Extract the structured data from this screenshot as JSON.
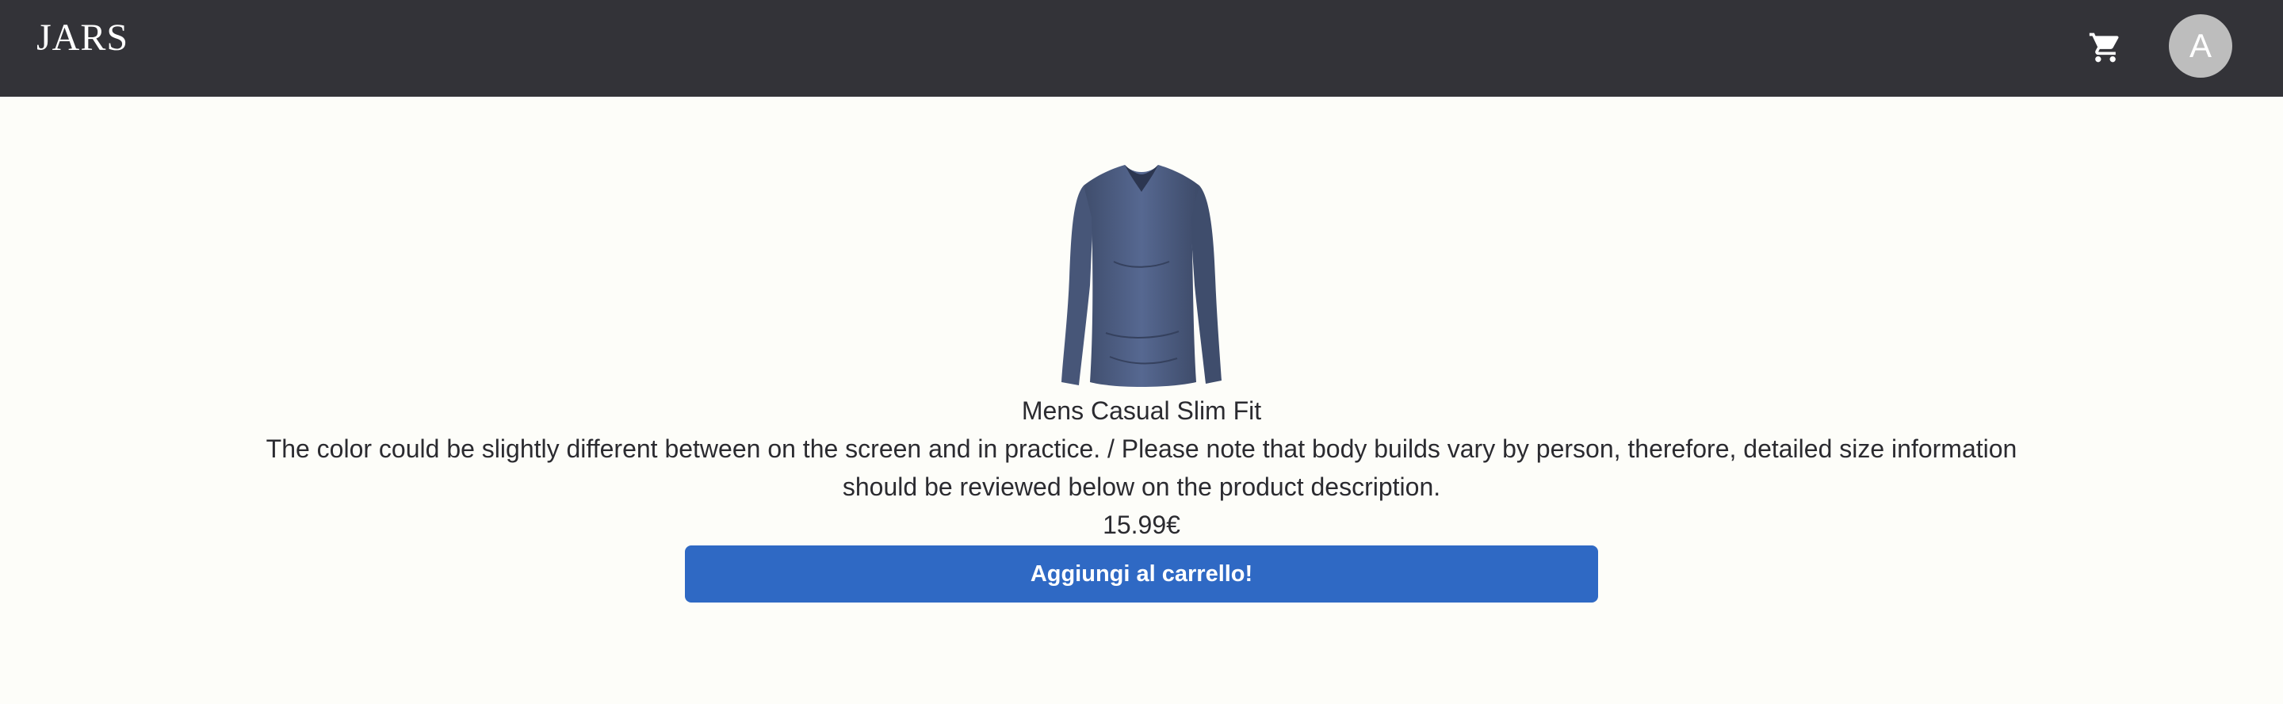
{
  "header": {
    "brand": "JARS",
    "cart_icon": "shopping-cart-icon",
    "avatar_initial": "A"
  },
  "product": {
    "image_icon": "long-sleeve-shirt",
    "title": "Mens Casual Slim Fit",
    "description": "The color could be slightly different between on the screen and in practice. / Please note that body builds vary by person, therefore, detailed size information should be reviewed below on the product description.",
    "price": "15.99€",
    "add_to_cart_label": "Aggiungi al carrello!"
  },
  "colors": {
    "navbar": "#333338",
    "background": "#fdfdf9",
    "button": "#2f69c4",
    "shirt": "#4e5e80",
    "avatar": "#bdbdbd"
  }
}
